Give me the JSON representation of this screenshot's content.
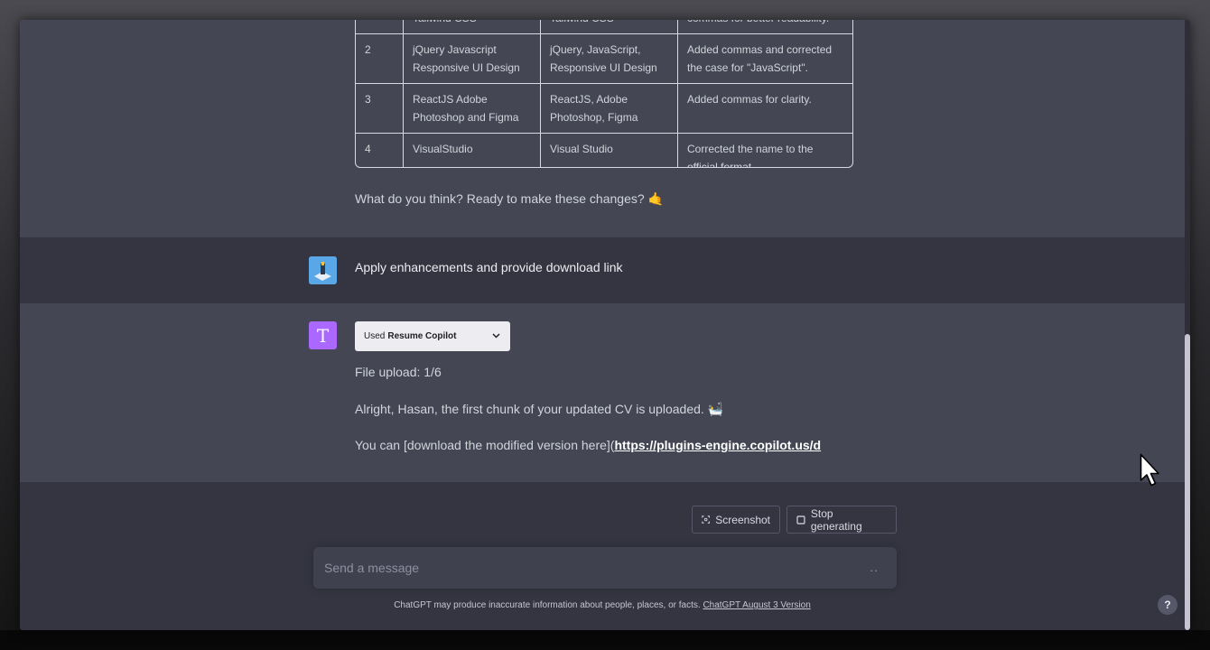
{
  "conversation": {
    "table": {
      "rows": [
        [
          "",
          "Tailwind CSS",
          "Tailwind CSS",
          "commas for better readability."
        ],
        [
          "2",
          "jQuery Javascript Responsive UI Design",
          "jQuery, JavaScript, Responsive UI Design",
          "Added commas and corrected the case for \"JavaScript\"."
        ],
        [
          "3",
          "ReactJS Adobe Photoshop and Figma",
          "ReactJS, Adobe Photoshop, Figma",
          "Added commas for clarity."
        ],
        [
          "4",
          "VisualStudio",
          "Visual Studio",
          "Corrected the name to the official format."
        ]
      ]
    },
    "assistant_question": "What do you think? Ready to make these changes? 🤙",
    "user_message": "Apply enhancements and provide download link",
    "bot_avatar_letter": "T",
    "plugin": {
      "used_label": "Used",
      "name": "Resume Copilot"
    },
    "lines": {
      "upload": "File upload: 1/6",
      "chunk": "Alright, Hasan, the first chunk of your updated CV is uploaded. 🛀",
      "download_prefix": "You can [download the modified version here](",
      "download_link": "https://plugins-engine.copilot.us/d"
    }
  },
  "actions": {
    "screenshot_label": "Screenshot",
    "stop_label": "Stop generating"
  },
  "composer": {
    "placeholder": "Send a message",
    "dots": ".."
  },
  "footer": {
    "disclaimer": "ChatGPT may produce inaccurate information about people, places, or facts.",
    "version_link": "ChatGPT August 3 Version"
  },
  "help_label": "?",
  "colors": {
    "background": "#343541",
    "assistant_bg": "#444654",
    "bot_avatar": "#ab68ff"
  }
}
